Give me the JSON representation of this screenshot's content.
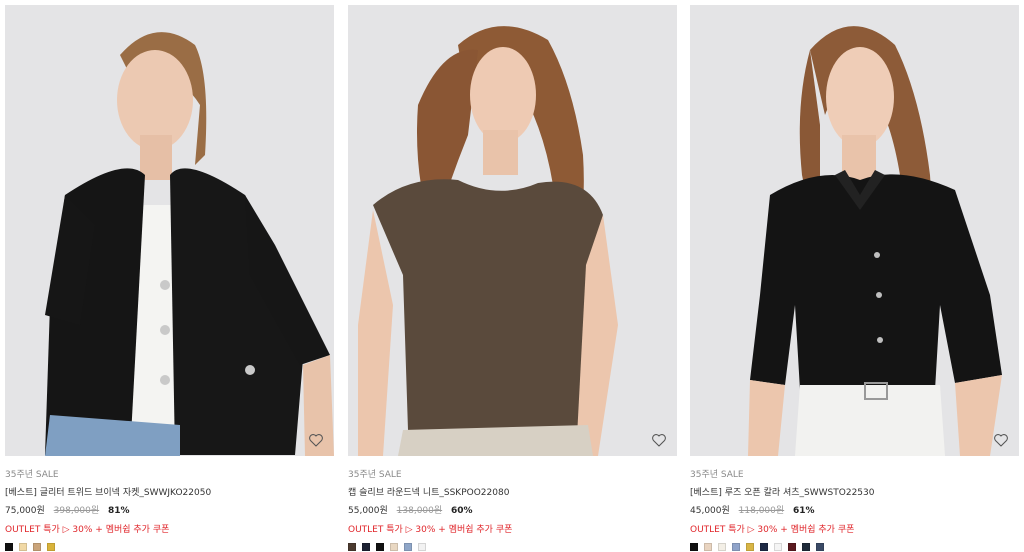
{
  "products": [
    {
      "tag": "35주년 SALE",
      "name": "[베스트] 글리터 트위드 브이넥 자켓_SWWJKO22050",
      "price": "75,000원",
      "original_price": "398,000원",
      "discount": "81%",
      "promo": "OUTLET 특가 ▷ 30% + 멤버쉽 추가 쿠폰",
      "image_icon": "model-black-tweed-jacket",
      "swatches": [
        "#111111",
        "#f1d9a6",
        "#caa47a",
        "#d9b33a"
      ]
    },
    {
      "tag": "35주년 SALE",
      "name": "캡 슬리브 라운드넥 니트_SSKPOO22080",
      "price": "55,000원",
      "original_price": "138,000원",
      "discount": "60%",
      "promo": "OUTLET 특가 ▷ 30% + 멤버쉽 추가 쿠폰",
      "image_icon": "model-brown-knit-top",
      "swatches": [
        "#4b3a2f",
        "#1d2233",
        "#111111",
        "#e9d8c2",
        "#8fa6c8",
        "#f2f2f2"
      ]
    },
    {
      "tag": "35주년 SALE",
      "name": "[베스트] 루즈 오픈 칼라 셔츠_SWWSTO22530",
      "price": "45,000원",
      "original_price": "118,000원",
      "discount": "61%",
      "promo": "OUTLET 특가 ▷ 30% + 멤버쉽 추가 쿠폰",
      "image_icon": "model-black-shirt",
      "swatches": [
        "#111111",
        "#e9d4c0",
        "#f3efe6",
        "#8fa3c9",
        "#d8b545",
        "#1e2a45",
        "#f5f5f5",
        "#5a1a1f",
        "#1f2b3a",
        "#3a4a66"
      ]
    }
  ],
  "wishlist_icon": "heart-outline-icon"
}
